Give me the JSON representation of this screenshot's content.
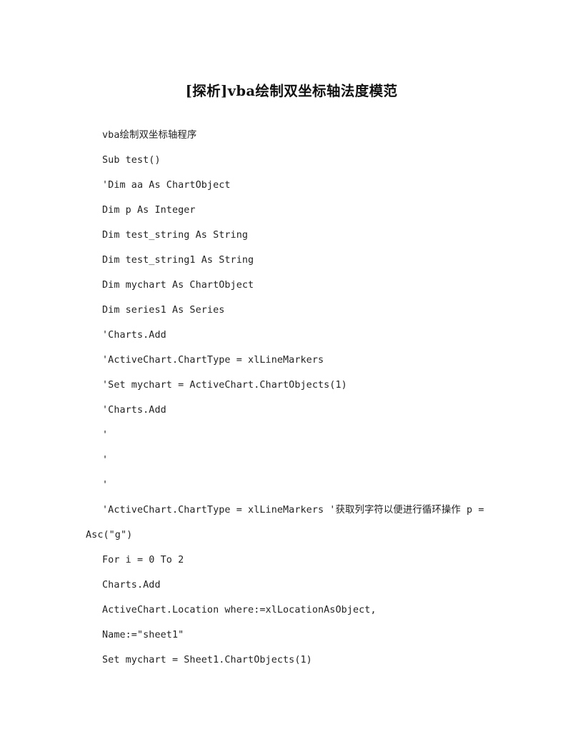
{
  "document": {
    "title": "[探析]vba绘制双坐标轴法度模范",
    "background_color": "#ffffff",
    "text_color": "#232323",
    "lines": [
      {
        "id": "line-intro",
        "text": "vba绘制双坐标轴程序"
      },
      {
        "id": "line-sub-test",
        "text": "Sub test()"
      },
      {
        "id": "line-dim-aa",
        "text": "'Dim aa As ChartObject"
      },
      {
        "id": "line-dim-p",
        "text": "Dim p As Integer"
      },
      {
        "id": "line-dim-teststring",
        "text": "Dim test_string As String"
      },
      {
        "id": "line-dim-teststring1",
        "text": "Dim test_string1 As String"
      },
      {
        "id": "line-dim-mychart",
        "text": "Dim mychart As ChartObject"
      },
      {
        "id": "line-dim-series1",
        "text": "Dim series1 As Series"
      },
      {
        "id": "line-charts-add-1",
        "text": "'Charts.Add"
      },
      {
        "id": "line-charttype-1",
        "text": "'ActiveChart.ChartType = xlLineMarkers"
      },
      {
        "id": "line-set-mychart-1",
        "text": "'Set mychart = ActiveChart.ChartObjects(1)"
      },
      {
        "id": "line-charts-add-2",
        "text": "'Charts.Add"
      },
      {
        "id": "line-apostrophe-1",
        "text": "'"
      },
      {
        "id": "line-apostrophe-2",
        "text": "'"
      },
      {
        "id": "line-apostrophe-3",
        "text": "'"
      },
      {
        "id": "line-charttype-2",
        "text": "'ActiveChart.ChartType = xlLineMarkers '获取列字符以便进行循环操作 p = Asc(\"g\")",
        "wraps": true
      },
      {
        "id": "line-for-loop",
        "text": "For i = 0 To 2"
      },
      {
        "id": "line-charts-add-3",
        "text": "Charts.Add"
      },
      {
        "id": "line-location",
        "text": "ActiveChart.Location where:=xlLocationAsObject,"
      },
      {
        "id": "line-name-sheet1",
        "text": "Name:=\"sheet1\""
      },
      {
        "id": "line-set-mychart-2",
        "text": "Set mychart = Sheet1.ChartObjects(1)"
      }
    ]
  }
}
